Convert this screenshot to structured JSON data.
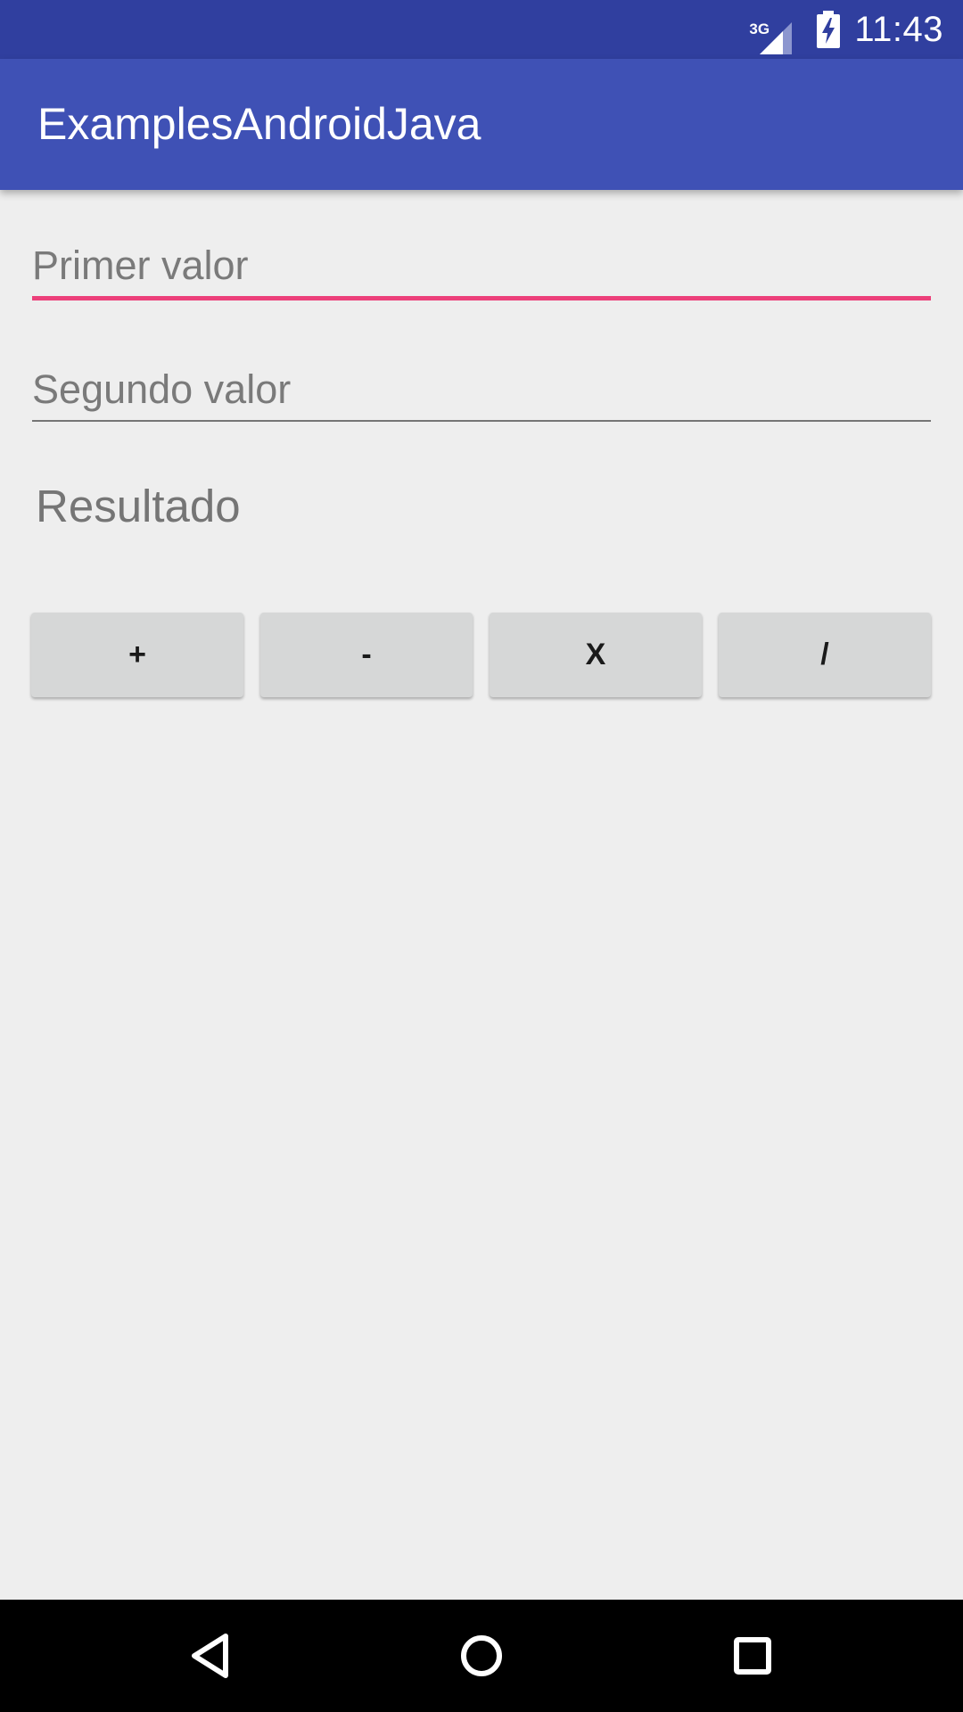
{
  "status_bar": {
    "network": "3G",
    "time": "11:43",
    "background_color": "#303f9f",
    "icons": [
      "network-3g-icon",
      "signal-icon",
      "battery-charging-icon"
    ]
  },
  "app_bar": {
    "title": "ExamplesAndroidJava",
    "background_color": "#3f51b5"
  },
  "form": {
    "first_value": {
      "value": "",
      "placeholder": "Primer valor",
      "focused": true,
      "underline_color": "#ec407a"
    },
    "second_value": {
      "value": "",
      "placeholder": "Segundo valor",
      "focused": false,
      "underline_color": "#757575"
    },
    "result_text": "Resultado"
  },
  "operations": [
    {
      "label": "+"
    },
    {
      "label": "-"
    },
    {
      "label": "X"
    },
    {
      "label": "/"
    }
  ],
  "nav_bar": {
    "icons": [
      "back-icon",
      "home-icon",
      "recents-icon"
    ]
  }
}
